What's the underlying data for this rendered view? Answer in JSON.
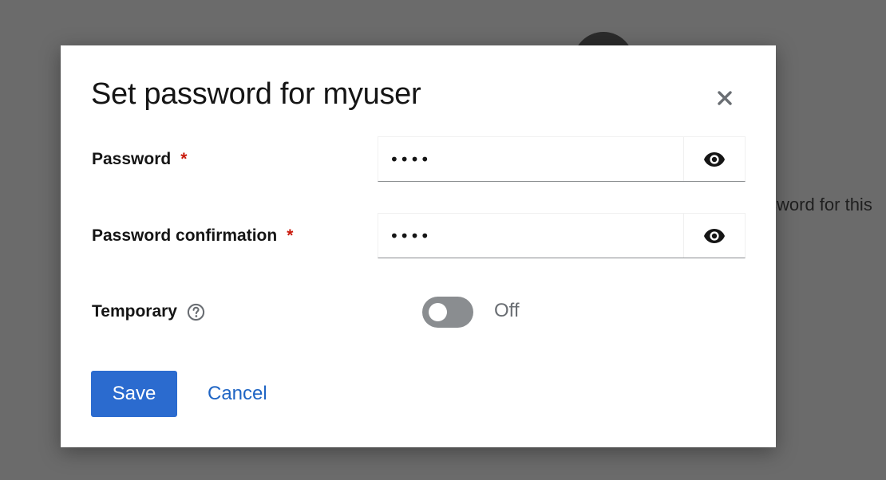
{
  "background": {
    "partial_text": "sword for this"
  },
  "dialog": {
    "title": "Set password for myuser",
    "fields": {
      "password": {
        "label": "Password",
        "required_mark": "*",
        "value": "1234"
      },
      "password_confirmation": {
        "label": "Password confirmation",
        "required_mark": "*",
        "value": "1234"
      },
      "temporary": {
        "label": "Temporary",
        "state_label": "Off",
        "checked": false
      }
    },
    "buttons": {
      "save": "Save",
      "cancel": "Cancel"
    }
  },
  "icons": {
    "close": "close-icon",
    "eye": "eye-icon",
    "help": "help-icon"
  },
  "colors": {
    "primary": "#2b6bcf",
    "link": "#1f65c4",
    "required": "#c9190b",
    "switch_off": "#8a8d90",
    "backdrop": "#6b6b6b"
  }
}
